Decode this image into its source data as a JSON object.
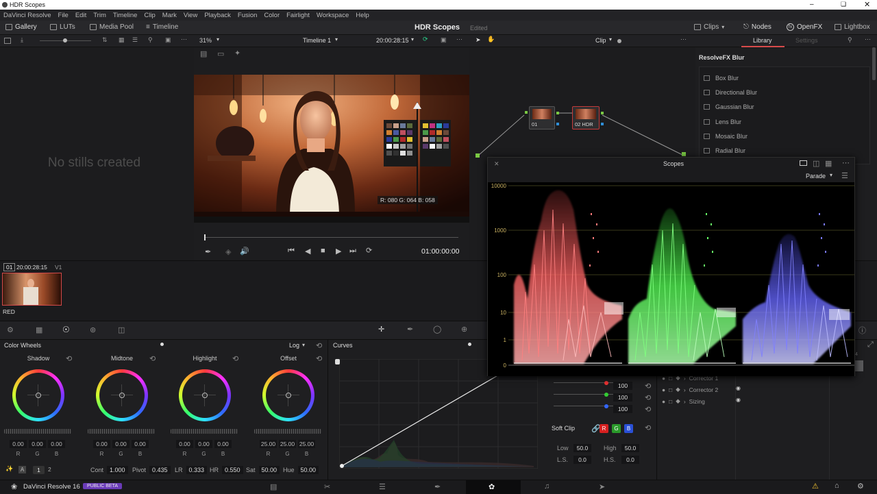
{
  "window": {
    "title": "HDR Scopes"
  },
  "menu": [
    "DaVinci Resolve",
    "File",
    "Edit",
    "Trim",
    "Timeline",
    "Clip",
    "Mark",
    "View",
    "Playback",
    "Fusion",
    "Color",
    "Fairlight",
    "Workspace",
    "Help"
  ],
  "toolbar": {
    "gallery": "Gallery",
    "luts": "LUTs",
    "media_pool": "Media Pool",
    "timeline": "Timeline",
    "project": "HDR Scopes",
    "status": "Edited",
    "clips": "Clips",
    "nodes": "Nodes",
    "openfx": "OpenFX",
    "lightbox": "Lightbox"
  },
  "viewer_bar": {
    "zoom": "31%",
    "timeline_name": "Timeline 1",
    "timecode": "20:00:28:15",
    "mode": "Clip"
  },
  "library": {
    "tab_library": "Library",
    "tab_settings": "Settings",
    "header": "ResolveFX Blur",
    "items": [
      "Box Blur",
      "Directional Blur",
      "Gaussian Blur",
      "Lens Blur",
      "Mosaic Blur",
      "Radial Blur"
    ]
  },
  "gallery": {
    "empty": "No stills created"
  },
  "viewer": {
    "pixel_readout": "R: 080 G: 064 B: 058",
    "playhead_tc": "01:00:00:00"
  },
  "node_graph": {
    "nodes": [
      {
        "num": "01",
        "label": "01"
      },
      {
        "num": "02",
        "label": "02 HDR"
      }
    ]
  },
  "clip": {
    "index": "01",
    "timecode": "20:00:28:15",
    "track": "V1",
    "name": "RED"
  },
  "scopes": {
    "title": "Scopes",
    "mode": "Parade",
    "y_ticks": [
      "10000",
      "1000",
      "100",
      "10",
      "1",
      "0"
    ]
  },
  "color_wheels": {
    "title": "Color Wheels",
    "mode": "Log",
    "wheels": [
      {
        "label": "Shadow",
        "values": [
          "0.00",
          "0.00",
          "0.00"
        ]
      },
      {
        "label": "Midtone",
        "values": [
          "0.00",
          "0.00",
          "0.00"
        ]
      },
      {
        "label": "Highlight",
        "values": [
          "0.00",
          "0.00",
          "0.00"
        ]
      },
      {
        "label": "Offset",
        "values": [
          "25.00",
          "25.00",
          "25.00"
        ]
      }
    ],
    "channels": [
      "R",
      "G",
      "B"
    ]
  },
  "adjust": {
    "page1": "1",
    "page2": "2",
    "cont_label": "Cont",
    "cont": "1.000",
    "pivot_label": "Pivot",
    "pivot": "0.435",
    "lr_label": "LR",
    "lr": "0.333",
    "hr_label": "HR",
    "hr": "0.550",
    "sat_label": "Sat",
    "sat": "50.00",
    "hue_label": "Hue",
    "hue": "50.00"
  },
  "curves": {
    "title": "Curves"
  },
  "soft_clip": {
    "label": "Soft Clip",
    "r": "R",
    "g": "G",
    "b": "B",
    "low_label": "Low",
    "low": "50.0",
    "high_label": "High",
    "high": "50.0",
    "ls_label": "L.S.",
    "ls": "0.0",
    "hs_label": "H.S.",
    "hs": "0.0",
    "ch_values": [
      "100",
      "100",
      "100"
    ]
  },
  "keyframes": {
    "items": [
      "Corrector 1",
      "Corrector 2",
      "Sizing"
    ]
  },
  "status": {
    "app": "DaVinci Resolve 16",
    "badge": "PUBLIC BETA"
  }
}
